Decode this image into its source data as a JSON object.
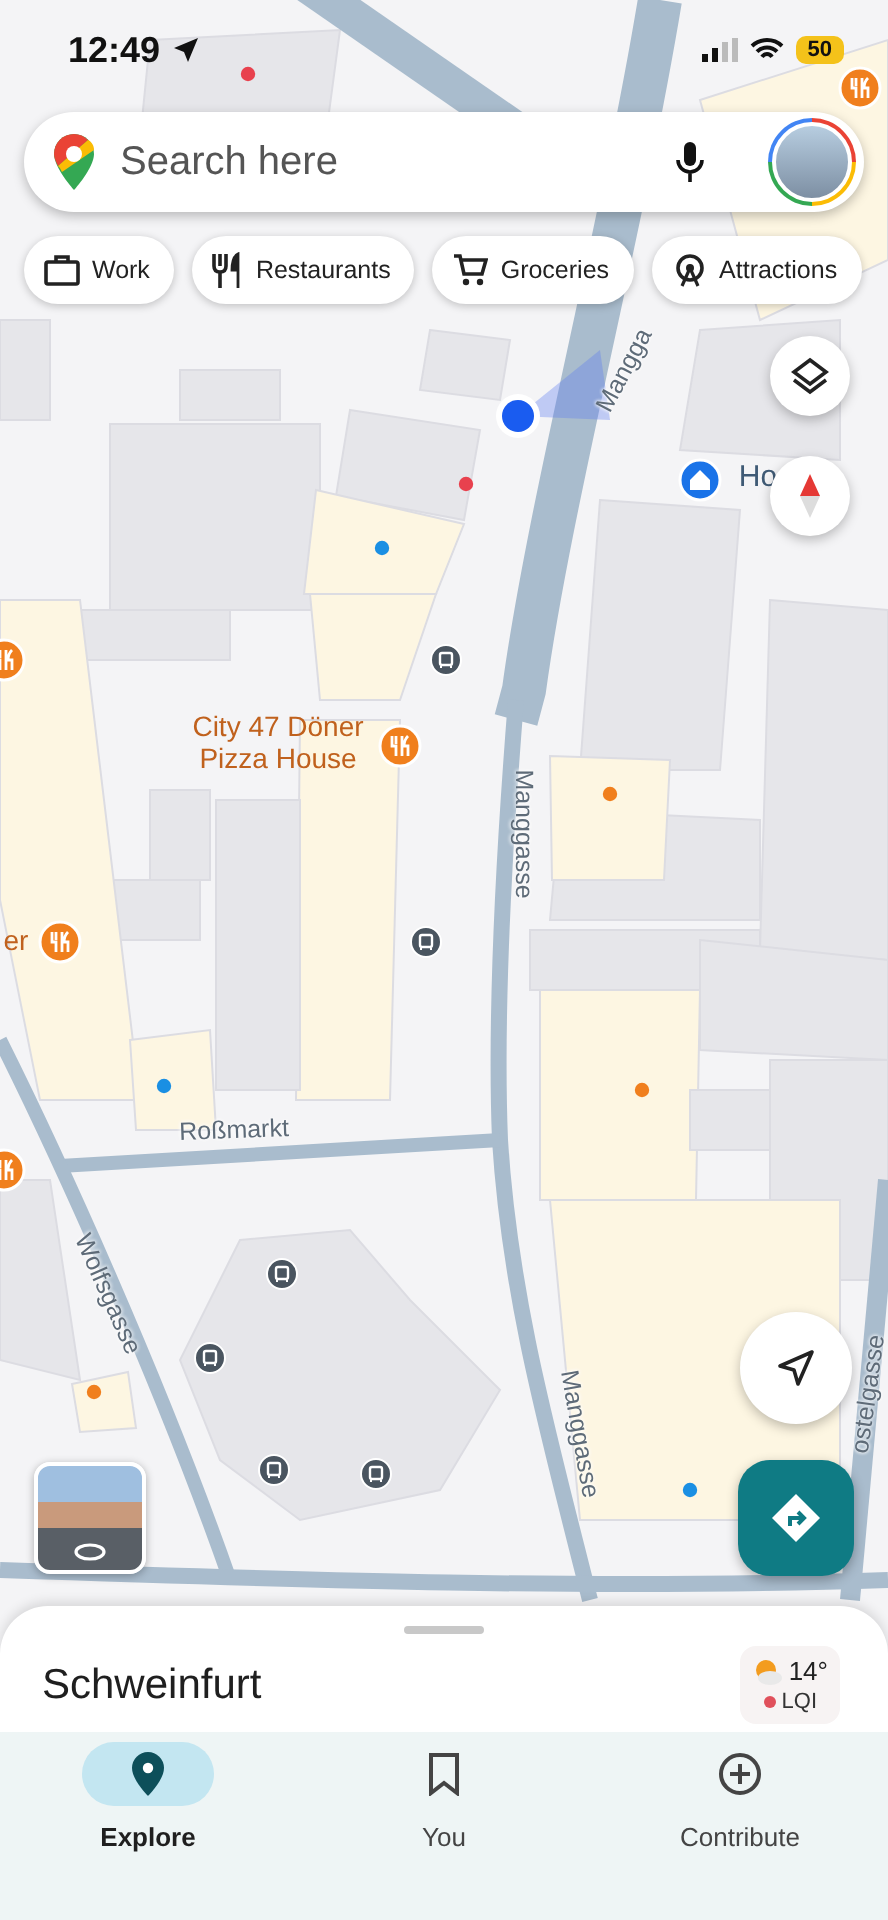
{
  "status_bar": {
    "time": "12:49",
    "battery": "50"
  },
  "search": {
    "placeholder": "Search here"
  },
  "chips": [
    {
      "kind": "work",
      "label": "Work"
    },
    {
      "kind": "restaurants",
      "label": "Restaurants"
    },
    {
      "kind": "groceries",
      "label": "Groceries"
    },
    {
      "kind": "attractions",
      "label": "Attractions"
    }
  ],
  "map": {
    "labels": [
      {
        "kind": "poi",
        "text": "City 47 Döner Pizza House"
      },
      {
        "kind": "street",
        "text": "Manggasse"
      },
      {
        "kind": "street",
        "text": "Mangga"
      },
      {
        "kind": "street",
        "text": "Manggasse"
      },
      {
        "kind": "street",
        "text": "Roßmarkt"
      },
      {
        "kind": "street",
        "text": "Wolfsgasse"
      },
      {
        "kind": "street",
        "text": "ostelgasse"
      },
      {
        "kind": "place",
        "text": "Ho"
      },
      {
        "kind": "poi",
        "text": "er"
      }
    ]
  },
  "sheet": {
    "title": "Schweinfurt",
    "weather": {
      "temperature": "14°",
      "air_quality": "LQI"
    }
  },
  "nav": [
    {
      "label": "Explore",
      "selected": true
    },
    {
      "label": "You",
      "selected": false
    },
    {
      "label": "Contribute",
      "selected": false
    }
  ]
}
